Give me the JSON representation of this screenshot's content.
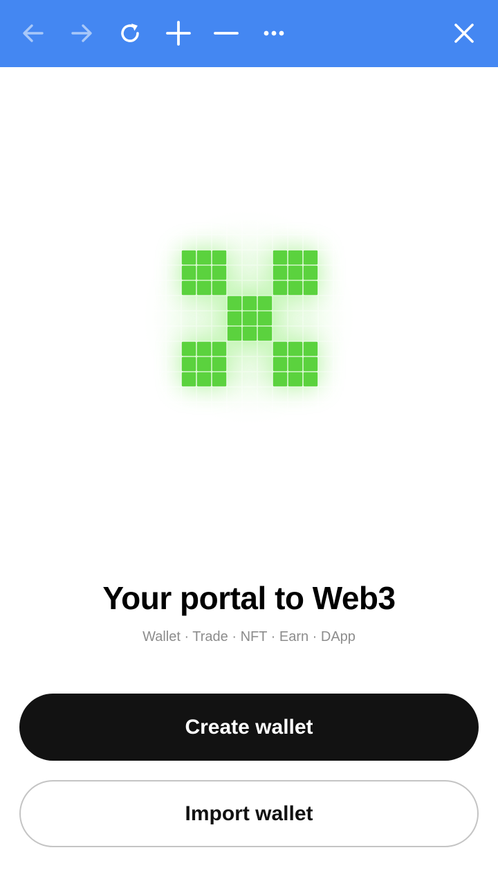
{
  "toolbar": {
    "icons": [
      "back-arrow-icon",
      "forward-arrow-icon",
      "refresh-icon",
      "plus-icon",
      "minus-icon",
      "more-icon",
      "close-icon"
    ],
    "color": "#4487f2"
  },
  "logo": {
    "color": "#5bd23e",
    "glow_color": "#b6f5a3"
  },
  "hero": {
    "title": "Your portal to Web3",
    "subtitle": "Wallet · Trade · NFT · Earn · DApp"
  },
  "actions": {
    "create_label": "Create wallet",
    "import_label": "Import wallet"
  }
}
